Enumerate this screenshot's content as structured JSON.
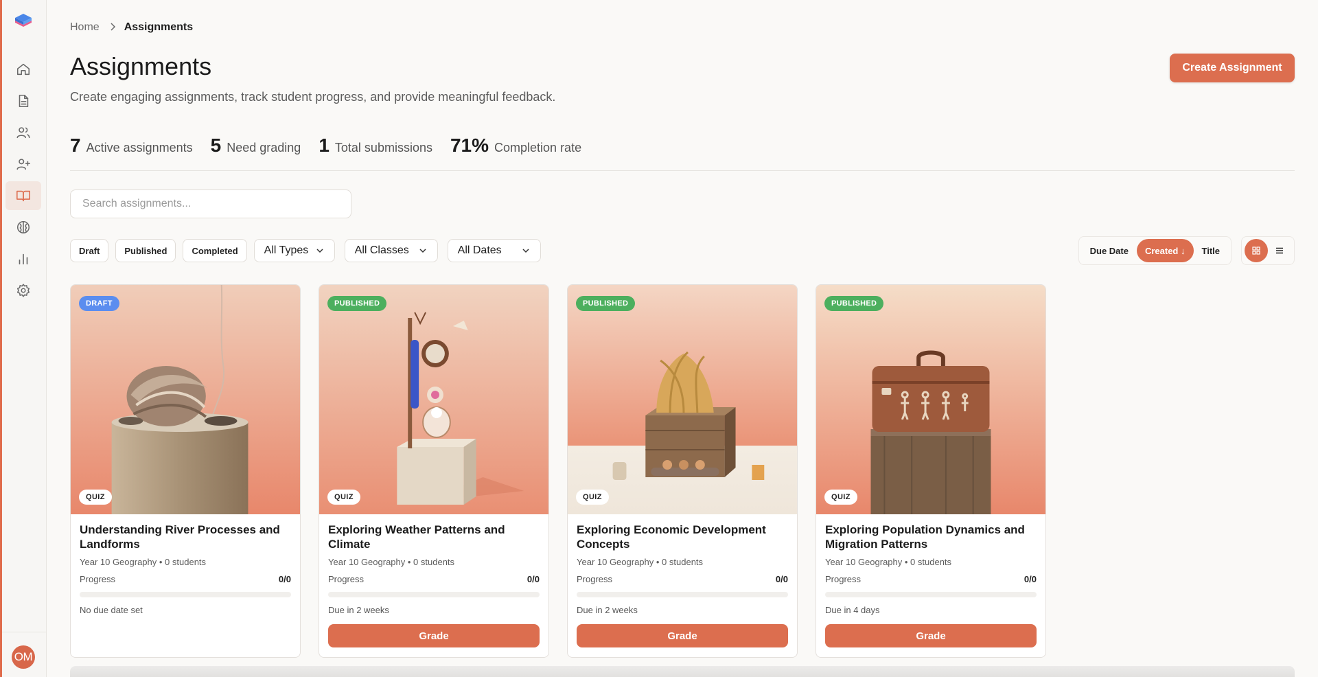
{
  "colors": {
    "accent": "#dc6e4f",
    "draft": "#5b8def",
    "published": "#4caf5e"
  },
  "sidebar": {
    "items": [
      {
        "name": "home-icon",
        "active": false
      },
      {
        "name": "document-icon",
        "active": false
      },
      {
        "name": "users-icon",
        "active": false
      },
      {
        "name": "user-plus-icon",
        "active": false
      },
      {
        "name": "book-open-icon",
        "active": true
      },
      {
        "name": "brain-icon",
        "active": false
      },
      {
        "name": "bar-chart-icon",
        "active": false
      },
      {
        "name": "gear-icon",
        "active": false
      }
    ],
    "avatar_initials": "OM"
  },
  "breadcrumb": {
    "home": "Home",
    "current": "Assignments"
  },
  "header": {
    "title": "Assignments",
    "subtitle": "Create engaging assignments, track student progress, and provide meaningful feedback.",
    "create_label": "Create Assignment"
  },
  "stats": [
    {
      "value": "7",
      "label": "Active assignments"
    },
    {
      "value": "5",
      "label": "Need grading"
    },
    {
      "value": "1",
      "label": "Total submissions"
    },
    {
      "value": "71%",
      "label": "Completion rate"
    }
  ],
  "search": {
    "placeholder": "Search assignments...",
    "value": ""
  },
  "filters": {
    "status_chips": [
      "Draft",
      "Published",
      "Completed"
    ],
    "types": "All Types",
    "classes": "All Classes",
    "dates": "All Dates"
  },
  "sort": {
    "options": [
      "Due Date",
      "Created ↓",
      "Title"
    ],
    "active": "Created ↓"
  },
  "view": {
    "active": "grid"
  },
  "cards": [
    {
      "status": "DRAFT",
      "status_color": "#5b8def",
      "type": "QUIZ",
      "image": "rock-on-pedestal",
      "title": "Understanding River Processes and Landforms",
      "meta": "Year 10 Geography • 0 students",
      "progress_label": "Progress",
      "progress": "0/0",
      "progress_value": 0,
      "due": "No due date set",
      "grade_label": ""
    },
    {
      "status": "PUBLISHED",
      "status_color": "#4caf5e",
      "type": "QUIZ",
      "image": "weather-instrument-on-block",
      "title": "Exploring Weather Patterns and Climate",
      "meta": "Year 10 Geography • 0 students",
      "progress_label": "Progress",
      "progress": "0/0",
      "progress_value": 0,
      "due": "Due in 2 weeks",
      "grade_label": "Grade"
    },
    {
      "status": "PUBLISHED",
      "status_color": "#4caf5e",
      "type": "QUIZ",
      "image": "wheat-on-crate",
      "title": "Exploring Economic Development Concepts",
      "meta": "Year 10 Geography • 0 students",
      "progress_label": "Progress",
      "progress": "0/0",
      "progress_value": 0,
      "due": "Due in 2 weeks",
      "grade_label": "Grade"
    },
    {
      "status": "PUBLISHED",
      "status_color": "#4caf5e",
      "type": "QUIZ",
      "image": "suitcase-on-pedestal",
      "title": "Exploring Population Dynamics and Migration Patterns",
      "meta": "Year 10 Geography • 0 students",
      "progress_label": "Progress",
      "progress": "0/0",
      "progress_value": 0,
      "due": "Due in 4 days",
      "grade_label": "Grade"
    }
  ]
}
